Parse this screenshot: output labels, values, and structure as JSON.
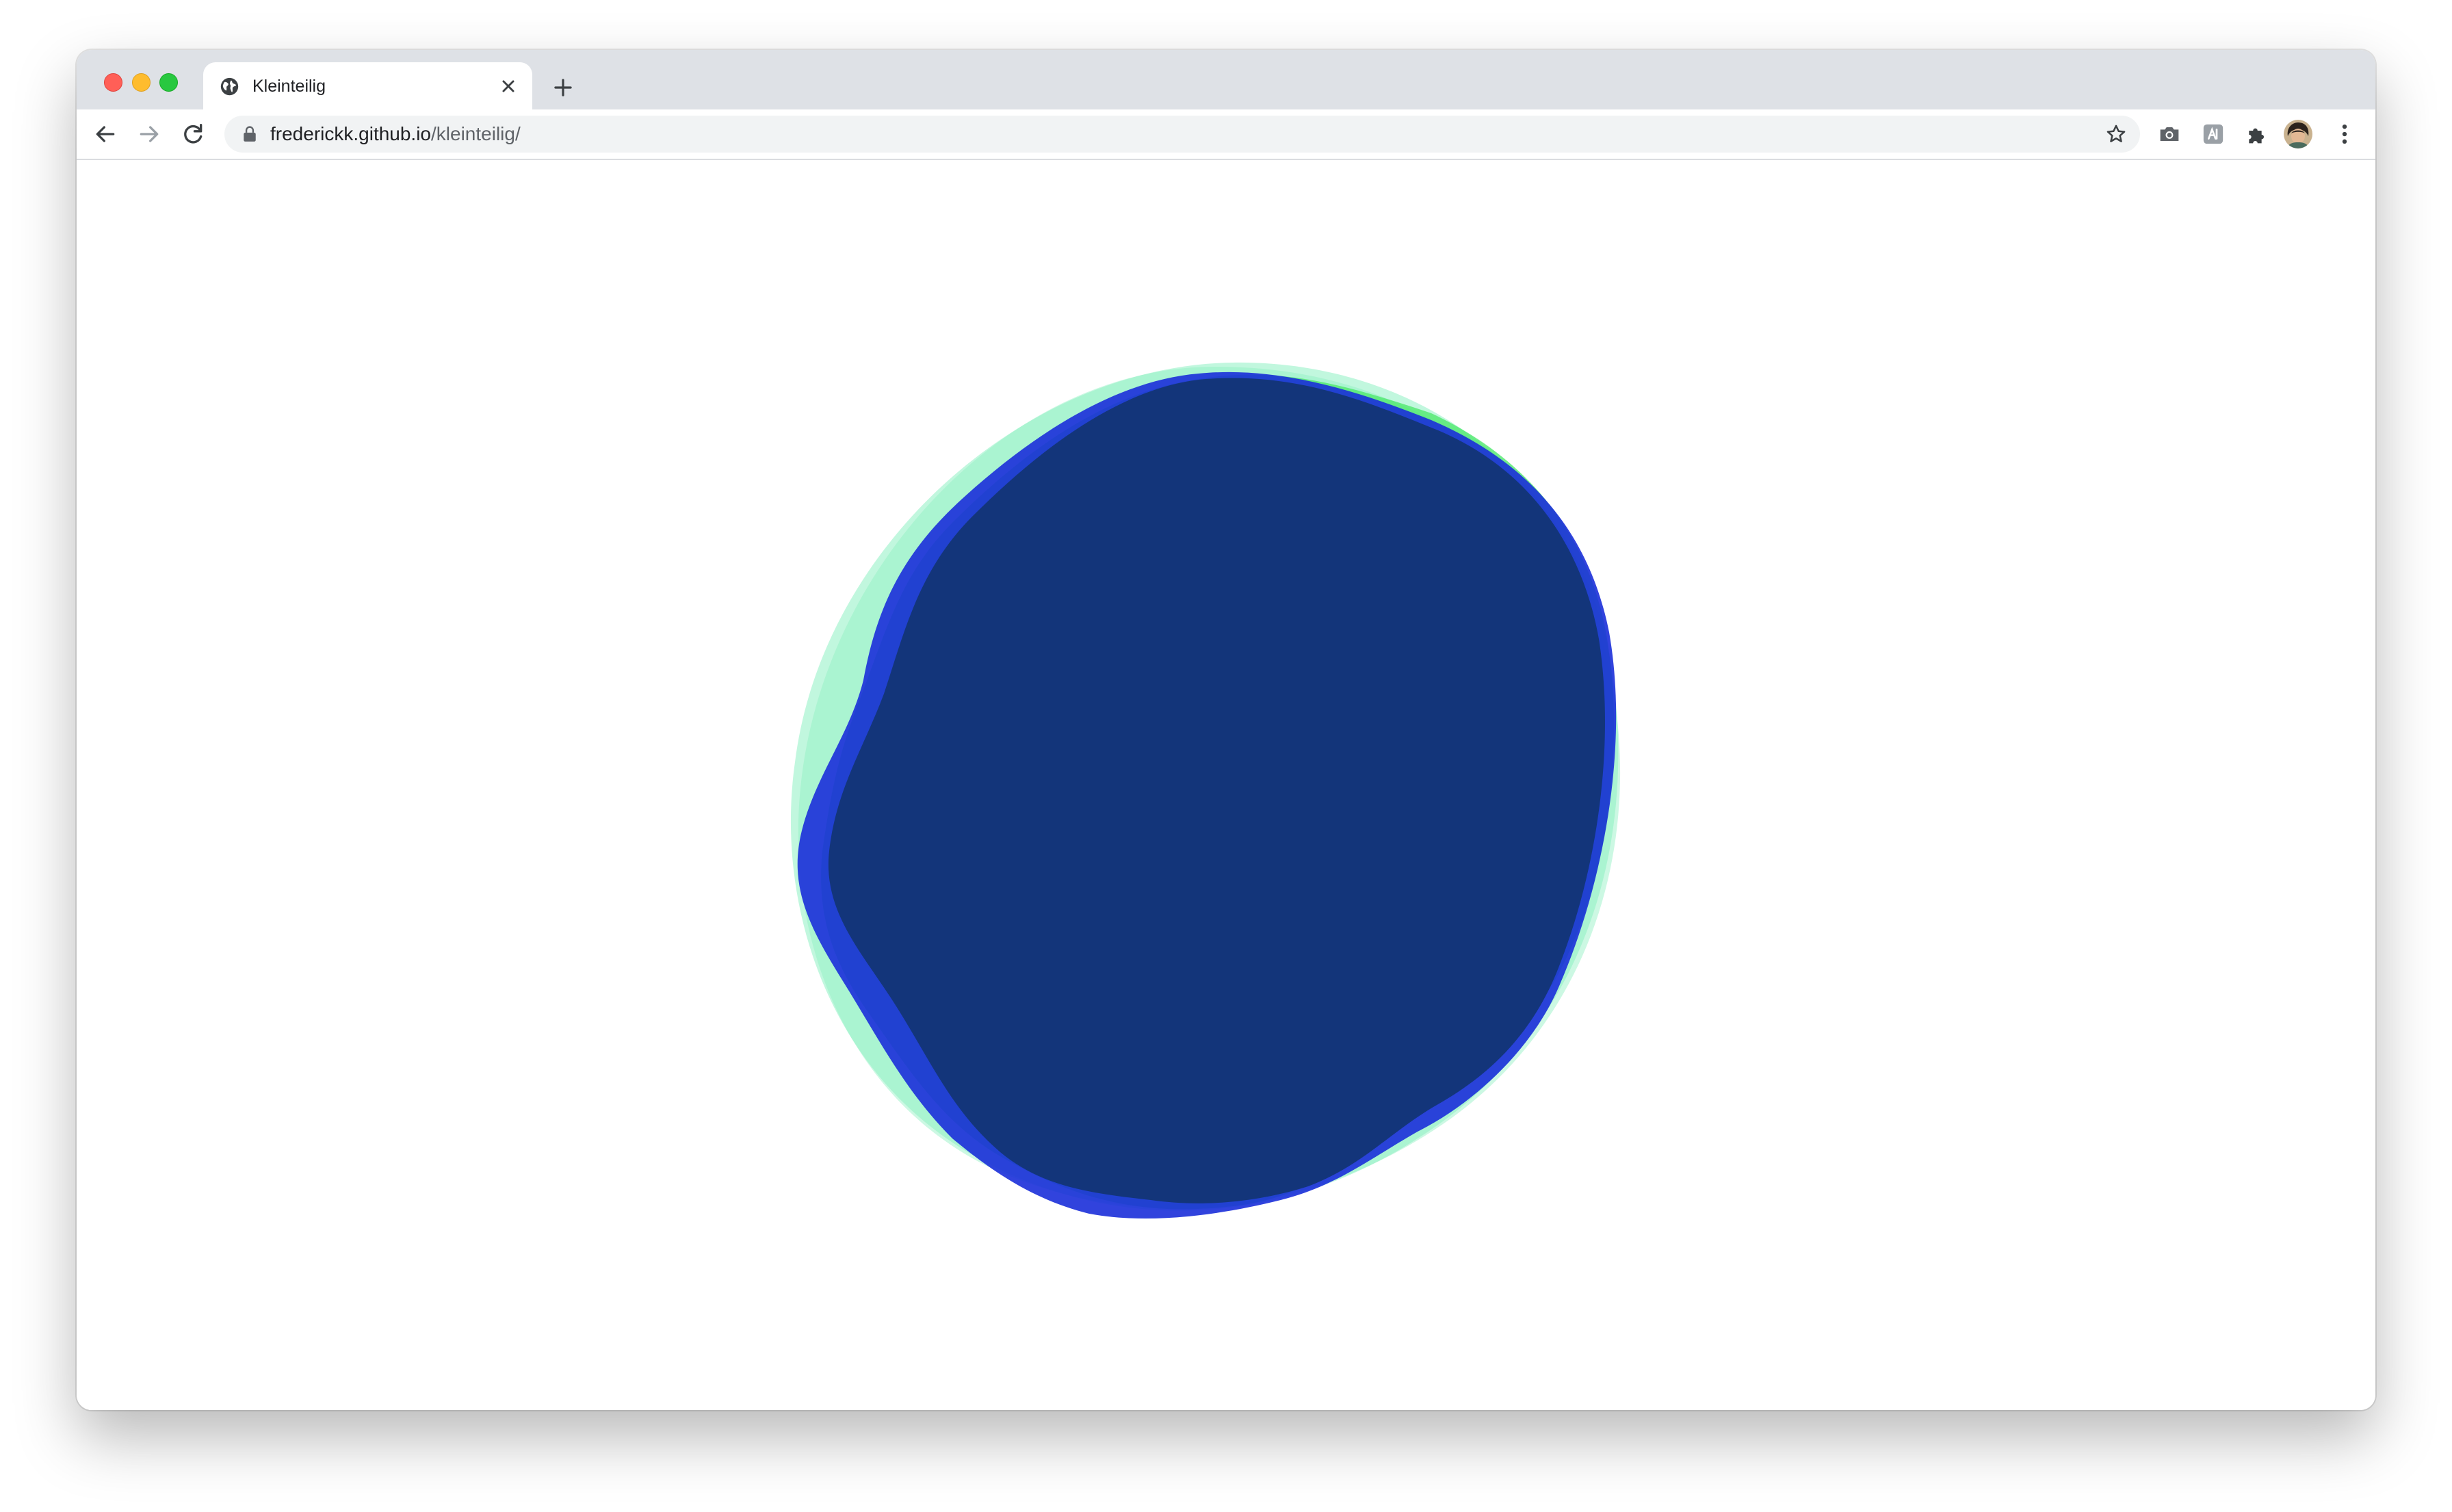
{
  "browser": {
    "tab": {
      "title": "Kleinteilig",
      "favicon": "globe-icon"
    },
    "address": {
      "host": "frederickk.github.io",
      "path": "/kleinteilig/"
    },
    "icons": {
      "back": "arrow-left-icon",
      "forward": "arrow-right-icon",
      "reload": "reload-icon",
      "lock": "lock-icon",
      "bookmark": "star-icon",
      "camera": "camera-icon",
      "extension_a": "translate-extension-icon",
      "extensions": "puzzle-icon",
      "profile": "avatar",
      "menu": "kebab-menu-icon",
      "new_tab": "plus-icon",
      "close_tab": "close-icon"
    }
  },
  "page": {
    "colors": {
      "background": "#ffffff",
      "blob_core": "#13357a",
      "blob_blue": "#1b2fd9",
      "blob_green": "#4fe86d",
      "blob_mint": "#8ef0c2"
    }
  }
}
